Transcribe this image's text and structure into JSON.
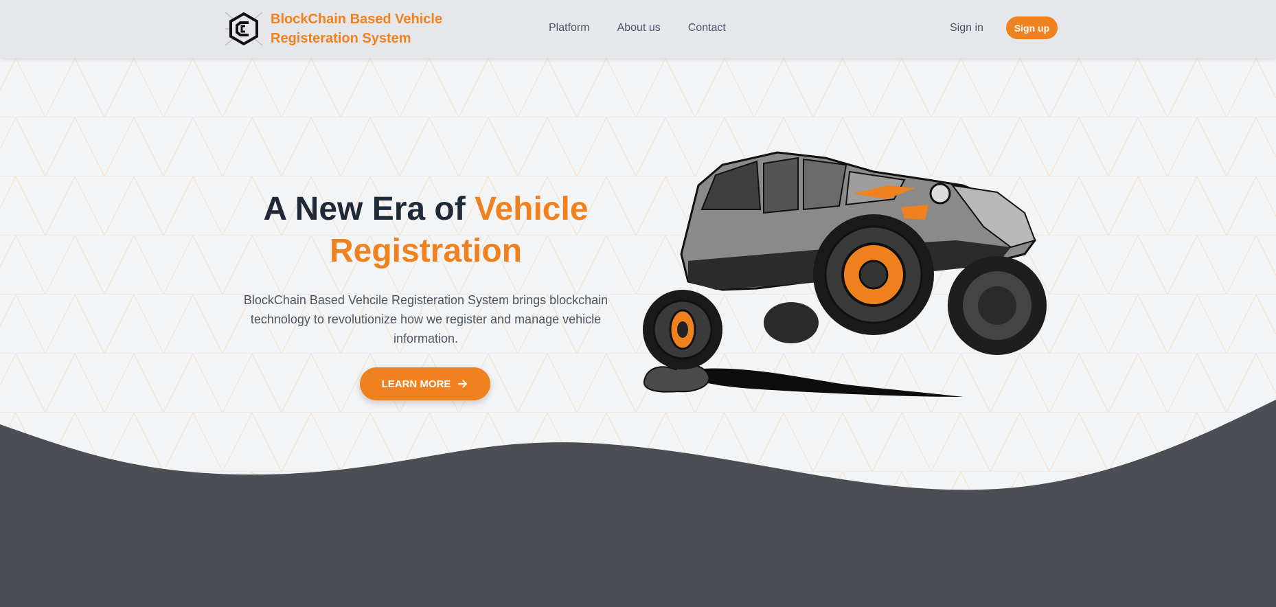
{
  "brand": {
    "name": "BlockChain Based Vehicle Registeration System",
    "logo_icon": "blockchain-cube-logo"
  },
  "nav": {
    "items": [
      {
        "label": "Platform"
      },
      {
        "label": "About us"
      },
      {
        "label": "Contact"
      }
    ]
  },
  "auth": {
    "signin_label": "Sign in",
    "signup_label": "Sign up"
  },
  "hero": {
    "title_part1": "A New Era of",
    "title_accent": "Vehicle Registration",
    "description": "BlockChain Based Vehcile Registeration System brings blockchain technology to revolutionize how we register and manage vehicle information.",
    "cta_label": "LEARN MORE",
    "cta_icon": "arrow-right-icon",
    "image": "offroad-jeep-illustration"
  },
  "colors": {
    "accent": "#f0811f",
    "header_bg": "#e5e7eb",
    "page_bg": "#f3f4f6",
    "dark_section": "#4b4e54",
    "text_dark": "#1f2937",
    "text_muted": "#4b5563"
  }
}
